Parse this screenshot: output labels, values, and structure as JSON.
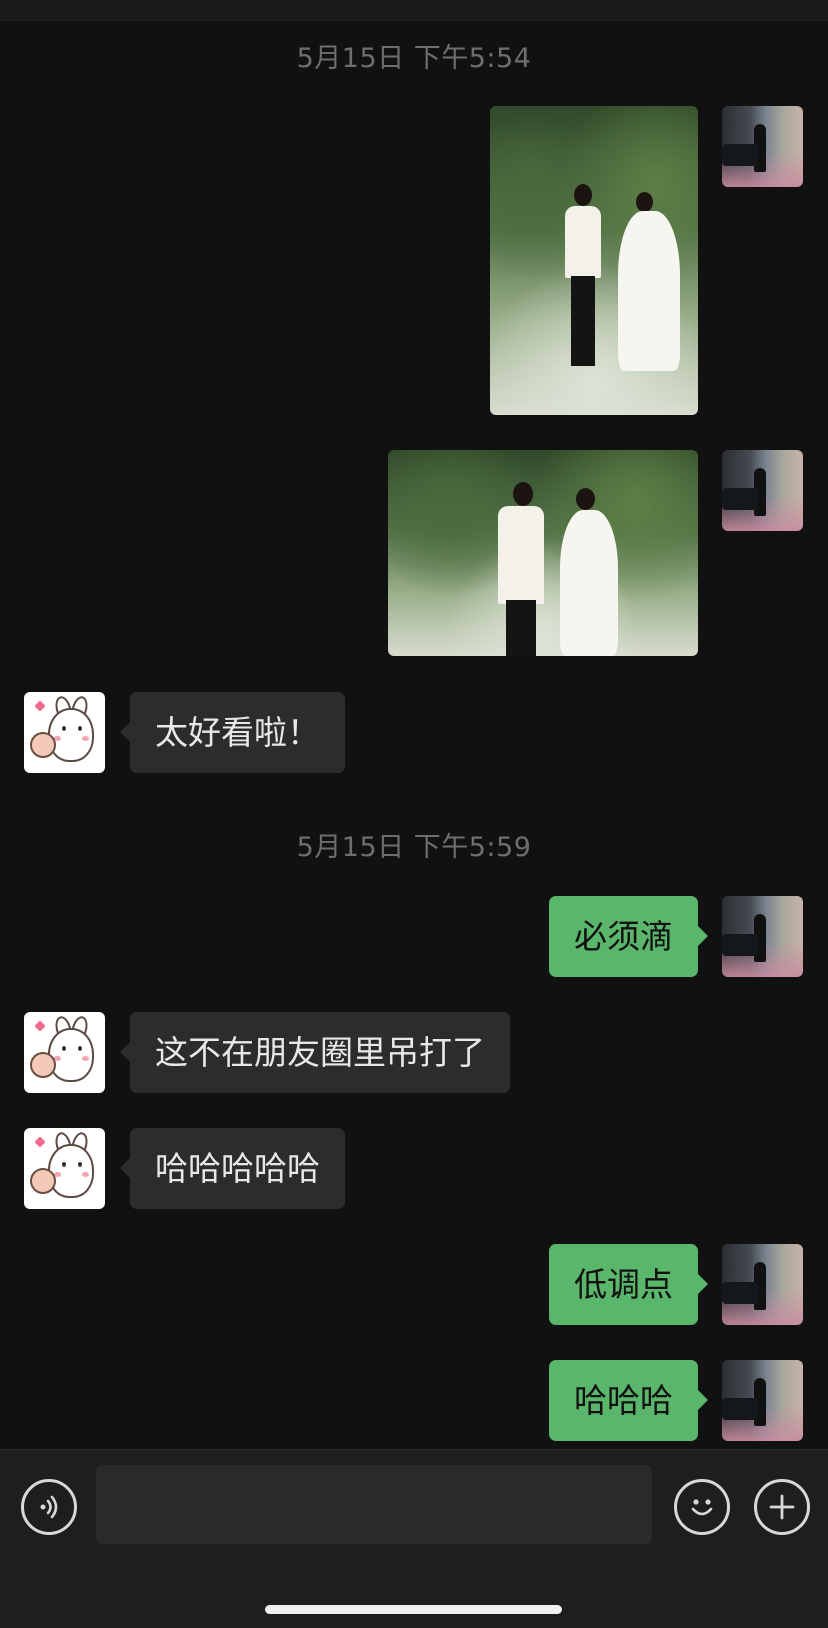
{
  "messages": {
    "timestamp_1": "5月15日 下午5:54",
    "timestamp_2": "5月15日 下午5:59",
    "photo_1": {
      "icon": "wedding-photo-portrait"
    },
    "photo_2": {
      "icon": "wedding-photo-landscape"
    },
    "reply_1": "太好看啦！",
    "sent_1": "必须滴",
    "reply_2": "这不在朋友圈里吊打了",
    "reply_3": "哈哈哈哈哈",
    "sent_2": "低调点",
    "sent_3": "哈哈哈"
  },
  "avatars": {
    "me": "man-with-car-avatar",
    "friend": "bunny-sticker-avatar"
  },
  "input_bar": {
    "voice_icon": "voice-icon",
    "emoji_icon": "emoji-icon",
    "more_icon": "plus-icon",
    "text_value": ""
  },
  "colors": {
    "background": "#111111",
    "sent_bubble": "#5ab66b",
    "received_bubble": "#2c2c2c",
    "timestamp": "#6e6e6e"
  }
}
